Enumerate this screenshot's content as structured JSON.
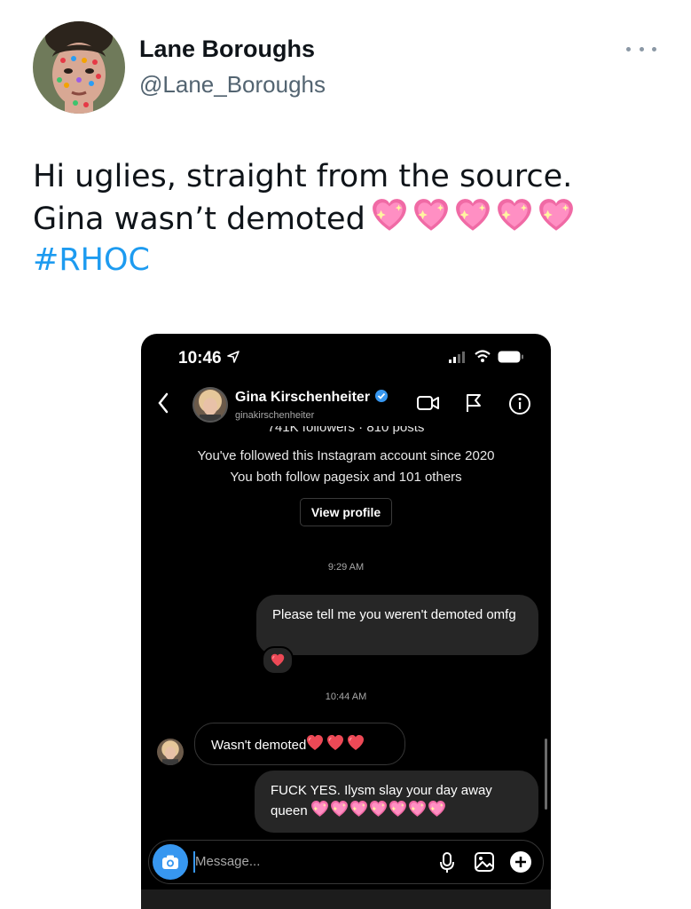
{
  "tweet": {
    "author_name": "Lane Boroughs",
    "author_handle": "@Lane_Boroughs",
    "text_line1": "Hi uglies,  straight from the source.",
    "text_line2": "Gina wasn’t demoted",
    "hashtag": "#RHOC",
    "emoji": "sparkling-heart"
  },
  "phone": {
    "status_time": "10:46",
    "contact_name": "Gina Kirschenheiter",
    "contact_username": "ginakirschenheiter",
    "stats_line": "741K followers · 810 posts",
    "followed_since": "You've followed this Instagram account since 2020",
    "mutuals": "You both follow pagesix and 101 others",
    "view_profile_label": "View profile",
    "messages": [
      {
        "time": "9:29 AM"
      },
      {
        "sender": "me",
        "text": "Please tell me you weren't demoted omfg",
        "reaction": "red-heart"
      },
      {
        "time": "10:44 AM"
      },
      {
        "sender": "contact",
        "text": "Wasn't demoted",
        "emoji": "red-heart x3"
      },
      {
        "sender": "me",
        "text": "FUCK YES. Ilysm slay your day away queen",
        "emoji": "sparkling-heart x7"
      }
    ],
    "composer_placeholder": "Message..."
  },
  "colors": {
    "hashtag": "#1d9bf0",
    "accent_blue": "#3797f0",
    "verified": "#3797f0",
    "heart_red": "#ed4956",
    "heart_pink": "#f06aa5"
  }
}
